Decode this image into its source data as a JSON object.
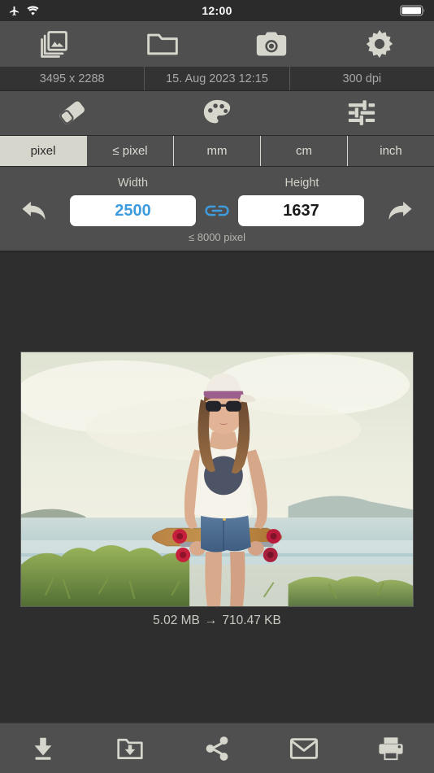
{
  "status_bar": {
    "airplane_icon": "airplane-icon",
    "wifi_icon": "wifi-icon",
    "time": "12:00",
    "battery_icon": "battery-full-icon"
  },
  "top_toolbar": {
    "buttons": [
      {
        "name": "gallery-button",
        "icon": "photo-library-icon"
      },
      {
        "name": "folder-button",
        "icon": "folder-icon"
      },
      {
        "name": "camera-button",
        "icon": "camera-icon"
      },
      {
        "name": "settings-button",
        "icon": "gear-icon"
      }
    ]
  },
  "info_bar": {
    "dimensions": "3495 x 2288",
    "date": "15. Aug 2023 12:15",
    "resolution": "300 dpi"
  },
  "edit_toolbar": {
    "buttons": [
      {
        "name": "eraser-button",
        "icon": "eraser-icon"
      },
      {
        "name": "palette-button",
        "icon": "palette-icon"
      },
      {
        "name": "adjustments-button",
        "icon": "sliders-icon"
      }
    ]
  },
  "unit_tabs": {
    "selected": "pixel",
    "items": [
      {
        "label": "pixel"
      },
      {
        "label": "≤ pixel"
      },
      {
        "label": "mm"
      },
      {
        "label": "cm"
      },
      {
        "label": "inch"
      }
    ]
  },
  "size_panel": {
    "undo_icon": "undo-arrow-icon",
    "redo_icon": "redo-arrow-icon",
    "width_label": "Width",
    "height_label": "Height",
    "width_value": "2500",
    "height_value": "1637",
    "width_placeholder": "Width",
    "height_placeholder": "Height",
    "link_icon": "link-chain-icon",
    "link_active": true,
    "limit_note": "≤ 8000 pixel"
  },
  "preview": {
    "image_alt": "woman-with-longboard-at-beach",
    "original_size": "5.02 MB",
    "arrow": "→",
    "new_size": "710.47 KB"
  },
  "bottom_toolbar": {
    "buttons": [
      {
        "name": "download-button",
        "icon": "download-icon"
      },
      {
        "name": "save-to-folder-button",
        "icon": "folder-download-icon"
      },
      {
        "name": "share-button",
        "icon": "share-icon"
      },
      {
        "name": "mail-button",
        "icon": "envelope-icon"
      },
      {
        "name": "print-button",
        "icon": "printer-icon"
      }
    ]
  },
  "colors": {
    "toolbar_gray": "#4f4f4f",
    "canvas_dark": "#2e2e2e",
    "status_dark": "#2b2b2b",
    "info_bar": "#333333",
    "icon_light": "#d6d6cc",
    "accent_blue": "#3e9bdd",
    "tab_active_bg": "#d6d6cc"
  }
}
